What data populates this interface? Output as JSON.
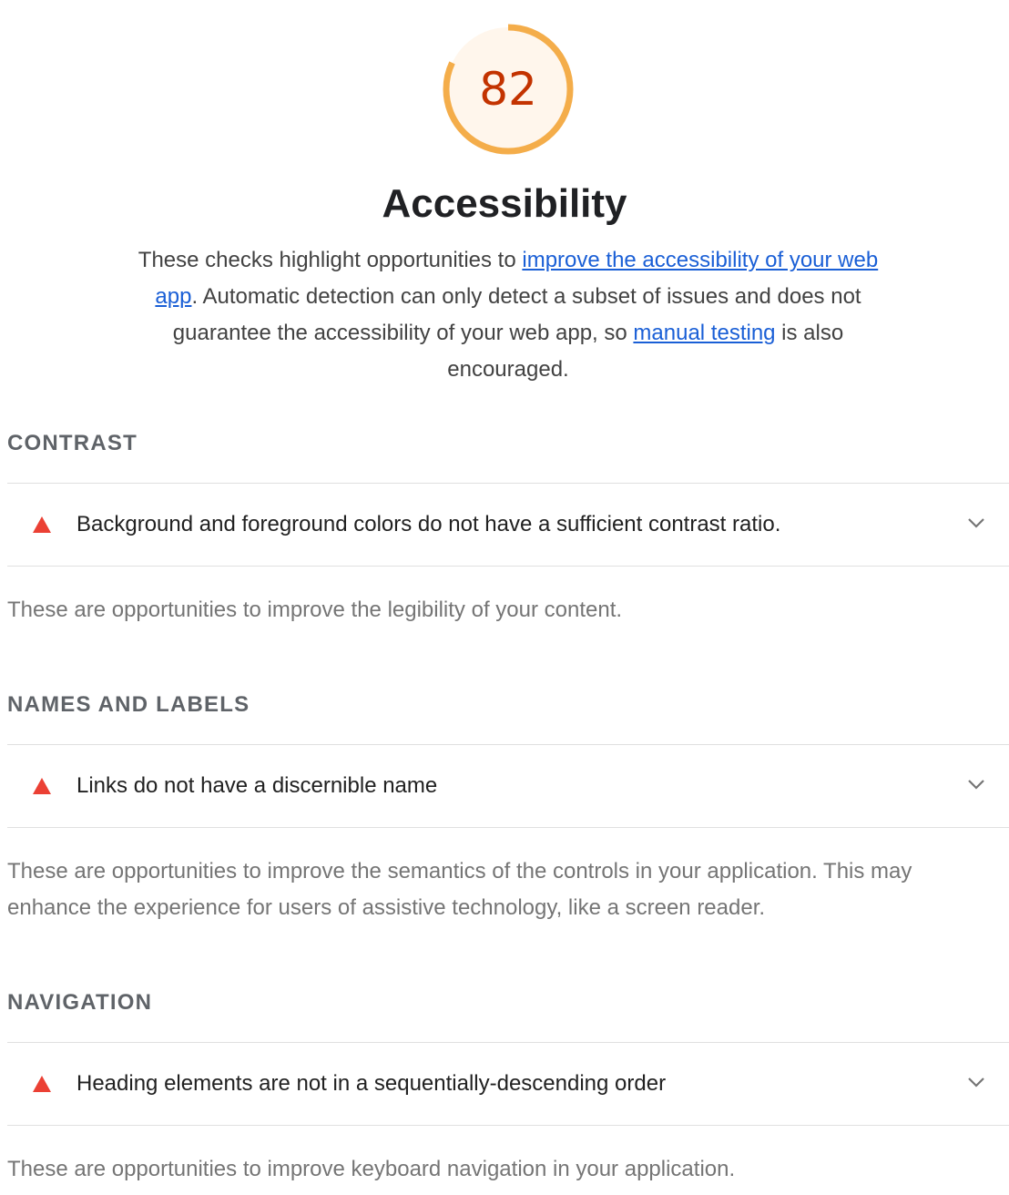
{
  "gauge": {
    "score": "82",
    "fraction": 0.82,
    "ring_color": "#f4ad4a",
    "fill_color": "#fff6ec",
    "score_color": "#c33300"
  },
  "category": {
    "title": "Accessibility",
    "description_1": "These checks highlight opportunities to ",
    "link_1": "improve the accessibility of your web app",
    "description_2": ". Automatic detection can only detect a subset of issues and does not guarantee the accessibility of your web app, so ",
    "link_2": "manual testing",
    "description_3": " is also encouraged."
  },
  "groups": [
    {
      "title": "CONTRAST",
      "audit": "Background and foreground colors do not have a sufficient contrast ratio.",
      "description": "These are opportunities to improve the legibility of your content."
    },
    {
      "title": "NAMES AND LABELS",
      "audit": "Links do not have a discernible name",
      "description": "These are opportunities to improve the semantics of the controls in your application. This may enhance the experience for users of assistive technology, like a screen reader."
    },
    {
      "title": "NAVIGATION",
      "audit": "Heading elements are not in a sequentially-descending order",
      "description": "These are opportunities to improve keyboard navigation in your application."
    }
  ],
  "icons": {
    "fail": "warning-triangle-icon",
    "expand": "chevron-down-icon"
  },
  "colors": {
    "fail": "#eb4034",
    "link": "#1a5fd6"
  }
}
